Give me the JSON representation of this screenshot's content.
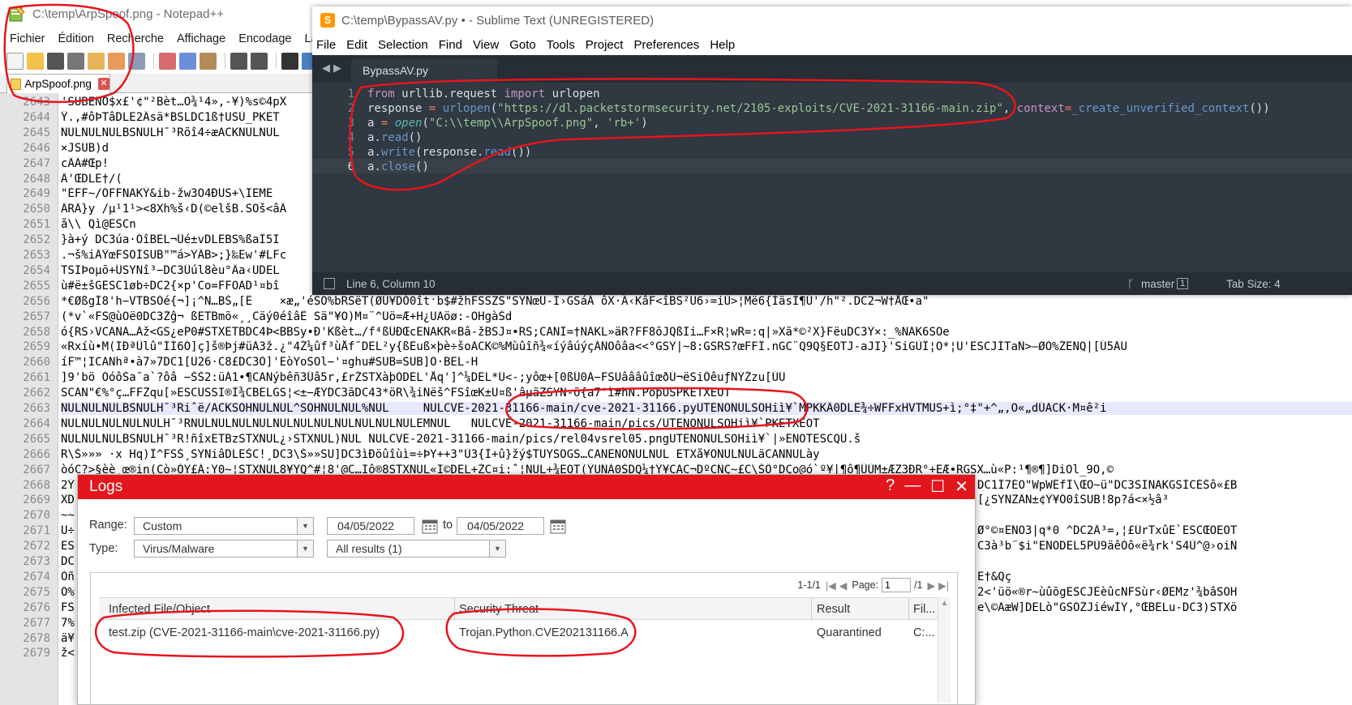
{
  "npp": {
    "title": "C:\\temp\\ArpSpoof.png - Notepad++",
    "menu": [
      "Fichier",
      "Édition",
      "Recherche",
      "Affichage",
      "Encodage",
      "Langa"
    ],
    "tab_label": "ArpSpoof.png",
    "lines": [
      {
        "n": "2643",
        "t": "'SUBENO$x£'¢\"²Bèt…O¾¹4»,-¥)%s©4pX"
      },
      {
        "n": "2644",
        "t": "Ÿ.,#ôÞTâDLE2Âsä*BSLDC1ß†USÙ_PKET"
      },
      {
        "n": "2645",
        "t": "NULNULNULBSNULH¯³Rõî4÷æACKNULNUL"
      },
      {
        "n": "2646",
        "t": "×JSUB)d"
      },
      {
        "n": "2647",
        "t": "cÂÃ#Œp!"
      },
      {
        "n": "2648",
        "t": "Â'ŒDLE†/("
      },
      {
        "n": "2649",
        "t": "\"ÈFF~/ÓFFNAKŸ&ib-žw3O4ÐUS+\\IEME"
      },
      {
        "n": "2650",
        "t": "ÄRÂ}y /µ¹1¹><8Xh%š‹D(©elšB.SOš<âÂ"
      },
      {
        "n": "2651",
        "t": "å\\\\ Qì@ESCn"
      },
      {
        "n": "2652",
        "t": "}à+ý DC3úa·ÓîBEL¬Ûé±vDLEBS%ßaÎ5I"
      },
      {
        "n": "2653",
        "t": ".¬š%iÂŸœFSOÌSUB\"™á>ÝÂB>;}‰Ew'#LFc"
      },
      {
        "n": "2654",
        "t": "TSIÞoµõ+ÛSYNî³−DC3Ûúl8èu°Âa‹UDEL"
      },
      {
        "n": "2655",
        "t": "ù#ë±šGESC1øb÷DC2{×p'Co=FFÕAD¹¤bî"
      },
      {
        "n": "2656",
        "t": "*€ØßgÏ8'h−VTBSÓé{¬]¡^N…BŠ„[Ê    ×æ„'éSO%bRSëT(ØÚ¥DÓ0îtˑb$#žhFSSZS\"SYNœU-I›GSáÂ ôX·Â‹KâF<îBS²Ü6›=iÙ>¦Më6{ÌäsÍ¶Ú'/h\"².DC2¬W†ÅŒ•a\""
      },
      {
        "n": "2657",
        "t": "(*v`«FS@ùÖë0DC3Žĝ¬ ßETBmõ«¸¸Ĉäý0éîâÊ Sä\"¥O)M¤¨^Úö=Æ+H¿UAöø:-ÖHgàŠd"
      },
      {
        "n": "2658",
        "t": "ó{RS›VCANA…Âž<GS¿eP0#STXETBDC4Þ<BBSy•Ð'Kßèt…/f⁴ßÛÐŒcENAKR«Bâ-žBSJ¤•RS;CANÎ=†NAKL»äR?FF8õJQßÌi…F×R¦wR=:q|»Xã*©²X}FëuDC3Ý×:_%NAK6SOe"
      },
      {
        "n": "2659",
        "t": "«Rxíù•M(ÍÐªÛlû\"ÍÍ6Ò]ç]š®Þj#üÀ3ž.¿\"4Ž¼ûf³ùÅfˉDEL²y{ßÈuß×þè÷šoACK©%Mùûîñ¾«íýâúýçÃÑÕôâa<<°GSÝ|~8:GSRS?œFFÎ.nGC¨Q9Q§EOTJ-aJI}'SiGÙÎ¦O*¦U'ESCJÍTaÑ>—ØÒ%ŽENQ|[Ú5ÁU"
      },
      {
        "n": "2660",
        "t": "íF™¦ICANhª•à7»7DC1[Û26·C8£DC3Ò]'EòYoSOl−'¤ghu#SUB=SUB]Ö·BEL-H"
      },
      {
        "n": "2661",
        "t": "]9'bö ÓóôŠa¯a`?ôâ −ŠŠ2:üÀ1•¶CANýbêñ3Ûâ5r,£rŽSTXàþÓDEL'Åq']^¼DEL*Ú<-;yôœ+[0ßÛ0Á−FSUâââûîœðÚ¬ëSiÔêuƒNÝŽzu[ÚÚ"
      },
      {
        "n": "2662",
        "t": "SCAN\"€%°ç…FFŽqu[»ESCUSSI®Ï¾CBELGS¦<±−ÆÝDC3ãDC43*öR\\¾iÑëš^FSîœK±U¤ß'âµãŽSYN-õ{a7'ì#hÑ.PoþUSPKETXEOT"
      },
      {
        "n": "2663",
        "t": "NULNULNULBSNULH¯³Riˆë/ACKSOHNULNUL^SOHNULNUL%NUL     NULCVE-2021-31166-main/cve-2021-31166.pyUTENONULSOHiì¥`MPKKÂ0DLE¾÷WFFxHVTMUS+ì;°‡\"+^„,Õ«„dÚACK·M¤ê²i"
      },
      {
        "n": "2664",
        "t": "NULNULNULNULNULH¯³RNULNULNULNULNULNULNULNULNULNULNULEMNUL   NULCVE-2021-31166-main/pics/UTENONULSOHiì¥`PKETXEOT"
      },
      {
        "n": "2665",
        "t": "NULNULNULBSNULH¯³R!ñîxETBzSTXNUL¿›STXNUL)NUL NULCVE-2021-31166-main/pics/rel04vsrel05.pngUTENONULSOHiì¥`|»ENOTESCQÛ.š"
      },
      {
        "n": "2666",
        "t": "R\\Š»»» ·x Hq)Î^FSŠ¸SYNiâDLEŠC!¸DC3\\Š»»SÜ]DC3ìÐöûîùì=÷ÞY++3\"Ù3{Ì+û}žý$TUYSOGS…CANENONULNUL ETXå¥ÕNULNULäCANNULày"
      },
      {
        "n": "2667",
        "t": "òóC?>§èè¸œ®in(Cò»ÒÝ£À:Y0~¦STXNUL8¥YQ^#¦8'@C…Iô®8STXNUL«I©DEL+ŽC¤i:ˆ¦NUL+¾EOT(ŸÜÑÃ0ŠDQ¼†Ÿ¥CAC¬DºCÑÇ~£C\\ŠÔ°DÇo@ó`º¥|¶ô¶ÛÙM±ÆZ3ÐR°+EÆ•RGSX…ù«P:¹¶®¶]DiOl_9O,©"
      },
      {
        "n": "2668",
        "t": "2Ý"
      },
      {
        "n": "2669",
        "t": "XD"
      },
      {
        "n": "2670",
        "t": "~~"
      },
      {
        "n": "2671",
        "t": "U÷"
      },
      {
        "n": "2672",
        "t": "ES"
      },
      {
        "n": "2673",
        "t": "DC"
      },
      {
        "n": "2674",
        "t": "Òñ"
      },
      {
        "n": "2675",
        "t": "Ó%"
      },
      {
        "n": "2676",
        "t": "FS"
      },
      {
        "n": "2677",
        "t": "7%"
      },
      {
        "n": "2678",
        "t": "ä¥"
      },
      {
        "n": "2679",
        "t": "ž<"
      }
    ],
    "right_fragments": [
      {
        "row": 2668,
        "t": "DC1Ï7ÉO\"WpWÊfÏ\\ŒÕ~ü\"DC3SINAKGSÌCÈŠô«£B"
      },
      {
        "row": 2669,
        "t": "[¿SYNZÂN±¢Ý¥Ó0îSUB!8p?á<×½â³"
      },
      {
        "row": 2671,
        "t": "Ø°©¤ENO3|q*0 ^DC2Ä³=,¦£ÚrTxûE`ESCŒÕEOT"
      },
      {
        "row": 2672,
        "t": "C3à³b¨$i\"ENODEL5PÙ9äêÒô«ë¾rk'S4Ù^@›oiÑ"
      },
      {
        "row": 2674,
        "t": "E†&Qç"
      },
      {
        "row": 2675,
        "t": "2<'üö«®r~ùûõgESCJÈèûcNFSùr‹ØEMz'¾bâSOH"
      },
      {
        "row": 2676,
        "t": "e\\©AæW]DELò\"GSÓŽJiéwÍY,°ŒBELu-DC3)STXö"
      }
    ]
  },
  "sublime": {
    "title": "C:\\temp\\BypassAV.py • - Sublime Text (UNREGISTERED)",
    "menu": [
      "File",
      "Edit",
      "Selection",
      "Find",
      "View",
      "Goto",
      "Tools",
      "Project",
      "Preferences",
      "Help"
    ],
    "tab_label": "BypassAV.py",
    "line_numbers": [
      "1",
      "2",
      "3",
      "4",
      "5",
      "6"
    ],
    "code": {
      "l1_kw1": "from",
      "l1_mod": " urllib.request ",
      "l1_kw2": "import",
      "l1_name": " urlopen",
      "l2_var": "response ",
      "l2_eq": "=",
      "l2_fn": " urlopen",
      "l2_p1": "(",
      "l2_str": "\"https://dl.packetstormsecurity.net/2105-exploits/CVE-2021-31166-main.zip\"",
      "l2_comma": ", ",
      "l2_ctx": "context",
      "l2_eq2": "=",
      "l2_arg": "_create_unverified_context",
      "l2_end": "())",
      "l3_var": "a ",
      "l3_eq": "=",
      "l3_fn": " open",
      "l3_p1": "(",
      "l3_str1": "\"C:\\\\temp\\\\ArpSpoof.png\"",
      "l3_comma": ", ",
      "l3_str2": "'rb+'",
      "l3_end": ")",
      "l4_obj": "a.",
      "l4_fn": "read",
      "l4_end": "()",
      "l5_obj": "a.",
      "l5_fn": "write",
      "l5_p": "(response.",
      "l5_fn2": "read",
      "l5_end": "())",
      "l6_obj": "a.",
      "l6_fn": "close",
      "l6_end": "()"
    },
    "status": {
      "position": "Line 6, Column 10",
      "branch": "master",
      "branch_count": "1",
      "tab_size": "Tab Size: 4"
    }
  },
  "logs": {
    "title": "Logs",
    "controls": [
      "?",
      "—",
      "☐",
      "✕"
    ],
    "range_label": "Range:",
    "range_value": "Custom",
    "date_from": "04/05/2022",
    "to_label": "to",
    "date_to": "04/05/2022",
    "type_label": "Type:",
    "type_value": "Virus/Malware",
    "results_value": "All results (1)",
    "pager": {
      "range": "1-1/1",
      "page_label": "Page:",
      "page_value": "1",
      "total": "/1"
    },
    "columns": [
      "Infected File/Object",
      "Security Threat",
      "Result",
      "Fil..."
    ],
    "rows": [
      {
        "file": "test.zip (CVE-2021-31166-main\\cve-2021-31166.py)",
        "threat": "Trojan.Python.CVE202131166.A",
        "result": "Quarantined",
        "fil": "C:..."
      }
    ]
  },
  "colors": {
    "annotation_red": "#e8141c",
    "logs_header": "#e2161c",
    "sublime_bg": "#303841",
    "npp_gutter": "#e4e4e4"
  }
}
